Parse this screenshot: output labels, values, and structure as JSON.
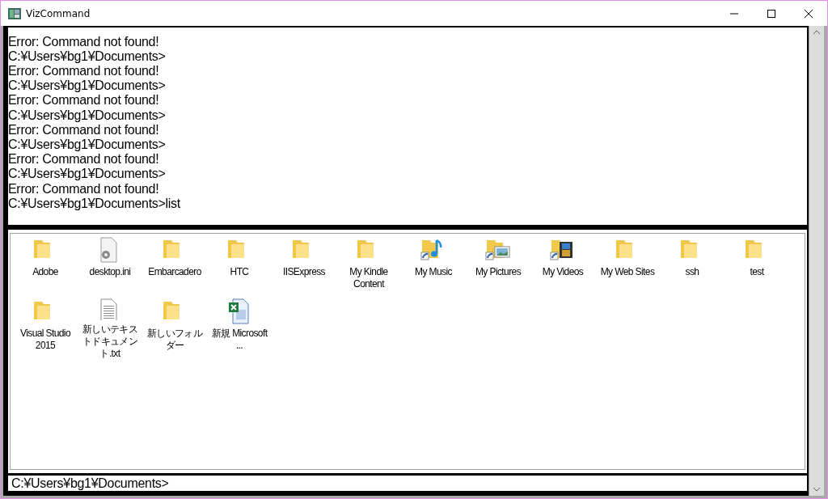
{
  "window": {
    "title": "VizCommand"
  },
  "console_lines": [
    "Error: Command not found!",
    "C:¥Users¥bg1¥Documents>",
    "Error: Command not found!",
    "C:¥Users¥bg1¥Documents>",
    "Error: Command not found!",
    "C:¥Users¥bg1¥Documents>",
    "Error: Command not found!",
    "C:¥Users¥bg1¥Documents>",
    "Error: Command not found!",
    "C:¥Users¥bg1¥Documents>",
    "Error: Command not found!",
    "C:¥Users¥bg1¥Documents>list"
  ],
  "files": [
    {
      "label": "Adobe",
      "kind": "folder"
    },
    {
      "label": "desktop.ini",
      "kind": "settings"
    },
    {
      "label": "Embarcadero",
      "kind": "folder"
    },
    {
      "label": "HTC",
      "kind": "folder"
    },
    {
      "label": "IISExpress",
      "kind": "folder"
    },
    {
      "label": "My Kindle Content",
      "kind": "folder"
    },
    {
      "label": "My Music",
      "kind": "music"
    },
    {
      "label": "My Pictures",
      "kind": "pictures"
    },
    {
      "label": "My Videos",
      "kind": "videos"
    },
    {
      "label": "My Web Sites",
      "kind": "folder"
    },
    {
      "label": "ssh",
      "kind": "folder"
    },
    {
      "label": "test",
      "kind": "folder"
    },
    {
      "label": "Visual Studio 2015",
      "kind": "folder"
    },
    {
      "label": "新しいテキストドキュメント.txt",
      "kind": "text"
    },
    {
      "label": "新しいフォルダー",
      "kind": "folder"
    },
    {
      "label": "新規 Microsoft ...",
      "kind": "excel"
    }
  ],
  "command_input": {
    "value": "C:¥Users¥bg1¥Documents>"
  }
}
